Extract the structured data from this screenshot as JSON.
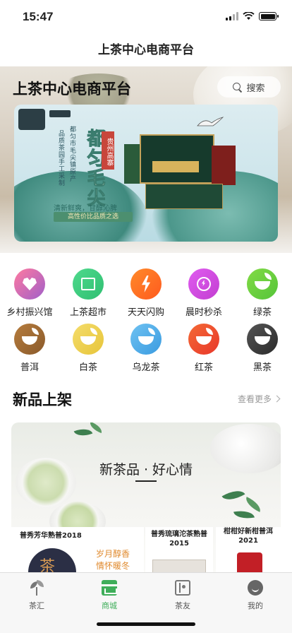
{
  "status_bar": {
    "time": "15:47"
  },
  "navbar": {
    "title": "上茶中心电商平台"
  },
  "hero": {
    "title": "上茶中心电商平台",
    "search_label": "搜索"
  },
  "banner": {
    "main_title": "都匀毛尖",
    "tag": "贵州高寨",
    "vertical_lines": [
      "都匀市毛尖镇原产",
      "品质茶园手工采制"
    ],
    "slogan": "清新鲜爽，甘醇沁脾",
    "pill": "高性价比品质之选"
  },
  "categories": [
    {
      "label": "乡村振兴馆",
      "icon": "heart-icon",
      "color": "#a05fc9",
      "color2": "#ff7aa0"
    },
    {
      "label": "上茶超市",
      "icon": "store-icon",
      "color": "#2fbf72",
      "color2": "#4fd98c"
    },
    {
      "label": "天天闪购",
      "icon": "lightning-icon",
      "color": "#ff5a1e",
      "color2": "#ff8a2a"
    },
    {
      "label": "晨时秒杀",
      "icon": "alarm-clock-icon",
      "color": "#c23ed1",
      "color2": "#e05cf0"
    },
    {
      "label": "绿茶",
      "icon": "green-tea-cup-icon",
      "color": "#55c43a",
      "color2": "#82db45"
    },
    {
      "label": "普洱",
      "icon": "puer-tea-cup-icon",
      "color": "#8a5a2b",
      "color2": "#b67c3d"
    },
    {
      "label": "白茶",
      "icon": "white-tea-cup-icon",
      "color": "#e7c53a",
      "color2": "#f4dc6b"
    },
    {
      "label": "乌龙茶",
      "icon": "oolong-tea-cup-icon",
      "color": "#3a9be0",
      "color2": "#6fc2f2"
    },
    {
      "label": "红茶",
      "icon": "black-tea-cup-icon",
      "color": "#e8372b",
      "color2": "#f46a35"
    },
    {
      "label": "黑茶",
      "icon": "dark-tea-cup-icon",
      "color": "#2b2b2b",
      "color2": "#555555"
    }
  ],
  "new_products": {
    "title": "新品上架",
    "see_more": "查看更多",
    "headline": "新茶品 · 好心情",
    "items": [
      {
        "name": "普秀芳华熟普2018",
        "subtitle_1": "岁月醇香",
        "subtitle_2": "情怀暖冬"
      },
      {
        "name": "普秀琉璃沱茶熟普2015"
      },
      {
        "name": "柑柑好新柑普洱2021"
      }
    ]
  },
  "tabbar": {
    "tabs": [
      {
        "label": "茶汇",
        "icon": "sprout-icon"
      },
      {
        "label": "商城",
        "icon": "shop-icon",
        "active": true
      },
      {
        "label": "茶友",
        "icon": "contacts-icon"
      },
      {
        "label": "我的",
        "icon": "profile-icon"
      }
    ]
  },
  "colors": {
    "accent": "#3fae5a"
  }
}
